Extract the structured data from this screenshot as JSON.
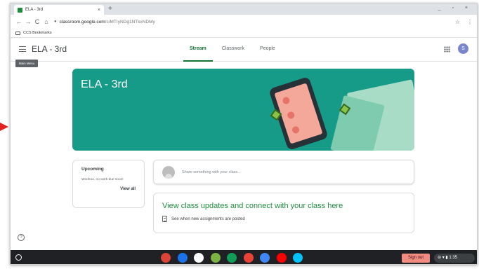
{
  "browser": {
    "tab_title": "ELA - 3rd",
    "tab_close": "×",
    "new_tab": "+",
    "window_controls": "_ ▫ ×",
    "url_host": "classroom.google.com",
    "url_path": "/c/MTIyNDg1NTkxNDMy",
    "bookmarks_label": "CCS Bookmarks"
  },
  "classroom": {
    "class_title": "ELA - 3rd",
    "tabs": [
      {
        "label": "Stream",
        "active": true
      },
      {
        "label": "Classwork",
        "active": false
      },
      {
        "label": "People",
        "active": false
      }
    ],
    "avatar_initial": "S",
    "tooltip": "Main Menu",
    "banner_title": "ELA - 3rd",
    "upcoming": {
      "title": "Upcoming",
      "body": "Woohoo, no work due soon!",
      "view_all": "View all"
    },
    "share_placeholder": "Share something with your class...",
    "updates": {
      "title": "View class updates and connect with your class here",
      "line": "See when new assignments are posted"
    },
    "help_glyph": "?"
  },
  "shelf": {
    "sign_out": "Sign out",
    "tray_text": "⊖ ▾ ▮ 1:35",
    "apps": [
      {
        "name": "chrome-icon",
        "color": "#db4437"
      },
      {
        "name": "files-icon",
        "color": "#1a73e8"
      },
      {
        "name": "camera-icon",
        "color": "#ffffff"
      },
      {
        "name": "plant-icon",
        "color": "#7cb342"
      },
      {
        "name": "sheets-icon",
        "color": "#0f9d58"
      },
      {
        "name": "gmail-icon",
        "color": "#ea4335"
      },
      {
        "name": "docs-icon",
        "color": "#4285f4"
      },
      {
        "name": "youtube-icon",
        "color": "#ff0000"
      },
      {
        "name": "play-store-icon",
        "color": "#00c4ff"
      }
    ]
  },
  "colors": {
    "banner": "#159b88",
    "accent": "#137333",
    "updates_title": "#1e8e3e"
  }
}
